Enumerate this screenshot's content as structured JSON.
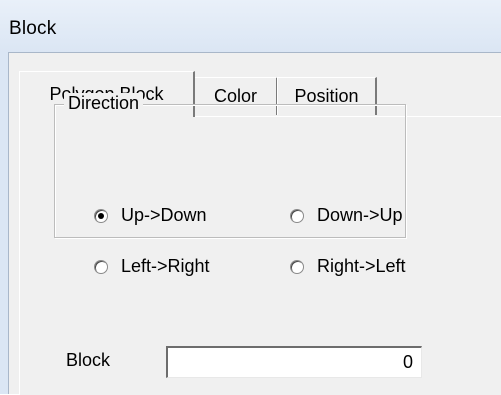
{
  "window": {
    "title": "Block"
  },
  "tabs": [
    {
      "label": "Polygon Block",
      "active": true
    },
    {
      "label": "Color",
      "active": false
    },
    {
      "label": "Position",
      "active": false
    }
  ],
  "direction": {
    "legend": "Direction",
    "options": [
      {
        "label": "Up->Down",
        "checked": true
      },
      {
        "label": "Down->Up",
        "checked": false
      },
      {
        "label": "Left->Right",
        "checked": false
      },
      {
        "label": "Right->Left",
        "checked": false
      }
    ]
  },
  "block_field": {
    "label": "Block",
    "value": "0"
  }
}
